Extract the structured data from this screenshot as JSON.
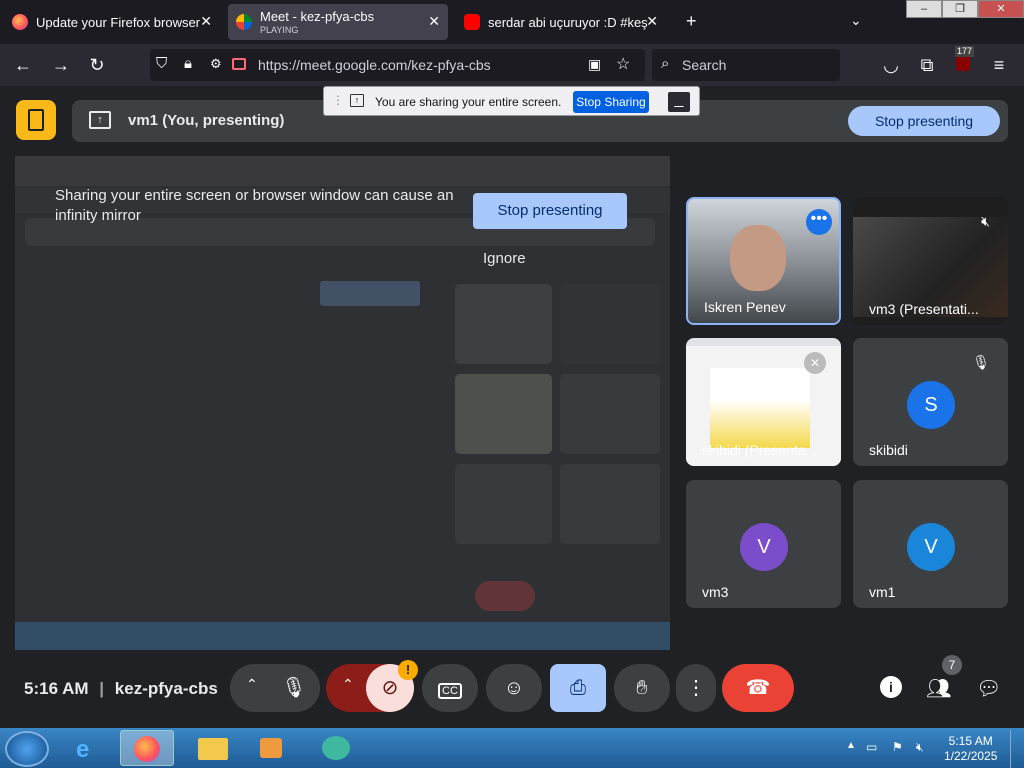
{
  "browser": {
    "tabs": [
      {
        "title": "Update your Firefox browser",
        "active": false
      },
      {
        "title": "Meet - kez-pfya-cbs",
        "subtitle": "PLAYING",
        "active": true
      },
      {
        "title": "serdar abi uçuruyor :D #keşfet",
        "active": false
      }
    ],
    "url": "https://meet.google.com/kez-pfya-cbs",
    "url_domain": "google.com",
    "search_placeholder": "Search",
    "extension_badge": "177"
  },
  "share_notification": {
    "text": "You are sharing your entire screen.",
    "stop_label": "Stop Sharing"
  },
  "meet": {
    "presenting_label": "vm1 (You, presenting)",
    "stop_presenting_label": "Stop presenting",
    "warning_text": "Sharing your entire screen or browser window can cause an infinity mirror",
    "warning_stop_label": "Stop presenting",
    "ignore_label": "Ignore",
    "participants": [
      {
        "name": "Iskren Penev",
        "type": "video"
      },
      {
        "name": "vm3 (Presentati...",
        "type": "video"
      },
      {
        "name": "skibidi (Presenta...",
        "type": "screen"
      },
      {
        "name": "skibidi",
        "initial": "S",
        "color": "#1a73e8",
        "type": "avatar"
      },
      {
        "name": "vm3",
        "initial": "V",
        "color": "#7c4dcb",
        "type": "avatar"
      },
      {
        "name": "vm1",
        "initial": "V",
        "color": "#1a86d9",
        "type": "avatar"
      }
    ],
    "time": "5:16 AM",
    "meeting_code": "kez-pfya-cbs",
    "participant_count": "7"
  },
  "taskbar": {
    "time": "5:15 AM",
    "date": "1/22/2025"
  },
  "colors": {
    "accent": "#a8c7fa",
    "end_call": "#ea4335",
    "background": "#202124",
    "tile": "#3c4043"
  }
}
